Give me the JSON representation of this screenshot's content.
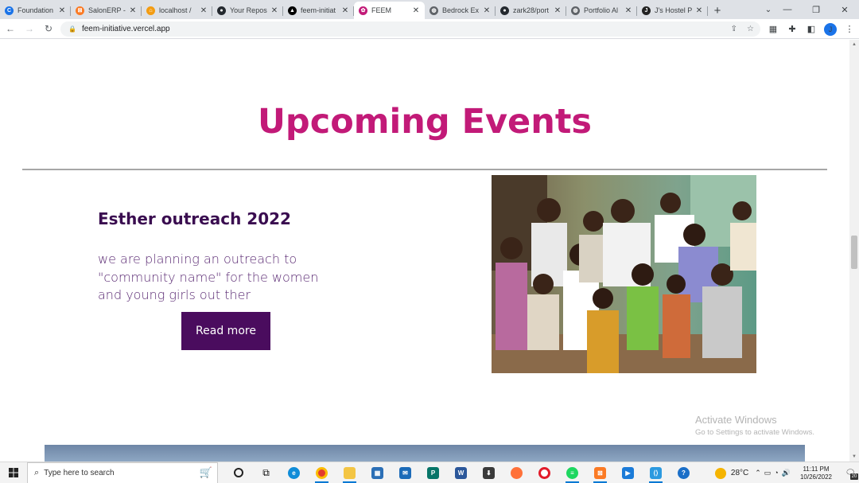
{
  "browser": {
    "tabs": [
      {
        "title": "Foundation",
        "icon": "google-icon",
        "color": "#1a73e8",
        "glyph": "C",
        "active": false
      },
      {
        "title": "SalonERP -",
        "icon": "xampp-icon",
        "color": "#fb7a24",
        "glyph": "⊠",
        "active": false
      },
      {
        "title": "localhost /",
        "icon": "phpmyadmin-icon",
        "color": "#f39c12",
        "glyph": "⌂",
        "active": false
      },
      {
        "title": "Your Repos",
        "icon": "github-icon",
        "color": "#24292f",
        "glyph": "●",
        "active": false
      },
      {
        "title": "feem-initiat",
        "icon": "vercel-icon",
        "color": "#000000",
        "glyph": "▲",
        "active": false
      },
      {
        "title": "FEEM",
        "icon": "feem-icon",
        "color": "#c21a78",
        "glyph": "✿",
        "active": true
      },
      {
        "title": "Bedrock Ex",
        "icon": "globe-icon",
        "color": "#5f6368",
        "glyph": "◍",
        "active": false
      },
      {
        "title": "zark28/port",
        "icon": "github-icon",
        "color": "#24292f",
        "glyph": "●",
        "active": false
      },
      {
        "title": "Portfolio Al",
        "icon": "globe-icon",
        "color": "#5f6368",
        "glyph": "◍",
        "active": false
      },
      {
        "title": "J's Hostel P",
        "icon": "hostel-icon",
        "color": "#222222",
        "glyph": "J",
        "active": false
      }
    ],
    "url": "feem-initiative.vercel.app"
  },
  "page": {
    "section_title": "Upcoming Events",
    "event": {
      "title": "Esther outreach 2022",
      "description": "we are planning an outreach to \"community name\" for the women and young girls out ther",
      "button_label": "Read more"
    }
  },
  "watermark": {
    "line1": "Activate Windows",
    "line2": "Go to Settings to activate Windows."
  },
  "taskbar": {
    "search_placeholder": "Type here to search",
    "weather": "28°C",
    "time": "11:11 PM",
    "date": "10/26/2022",
    "notification_count": "20"
  },
  "colors": {
    "title": "#c21a78",
    "event_title": "#3a0d50",
    "button_bg": "#4a0c5e"
  }
}
